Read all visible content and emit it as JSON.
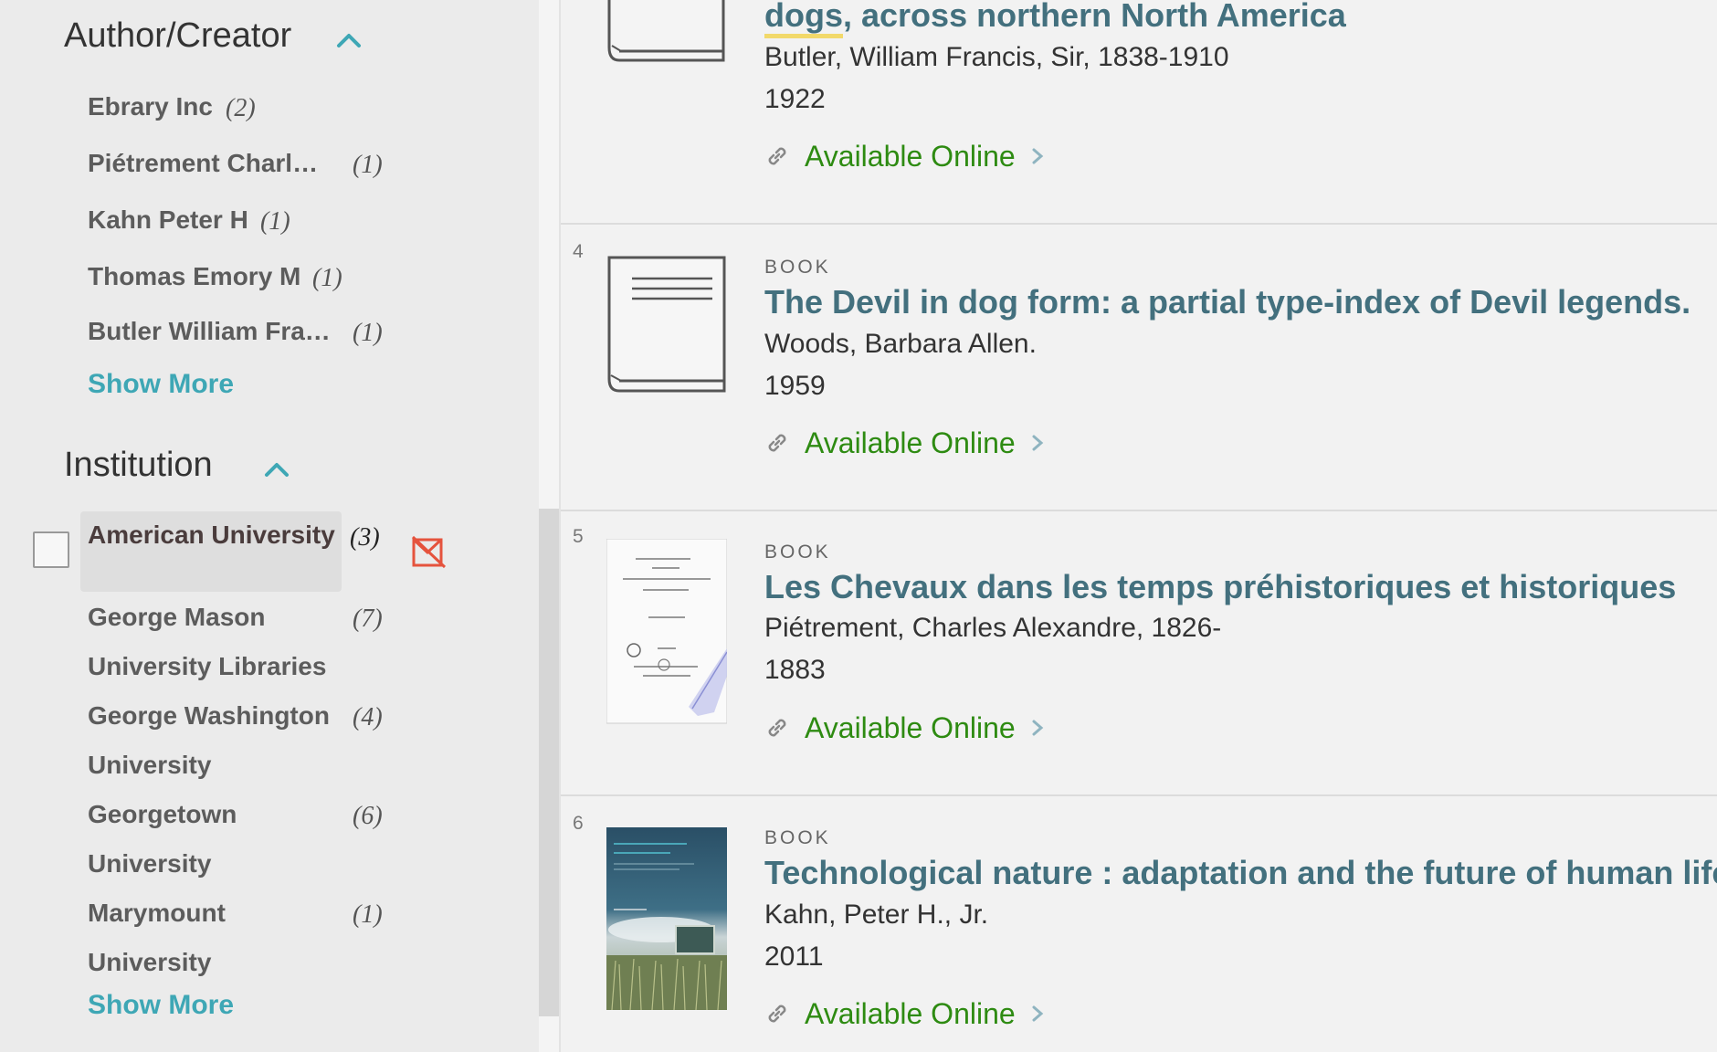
{
  "sidebar": {
    "author_section": {
      "title": "Author/Creator",
      "items": [
        {
          "label": "Ebrary Inc",
          "count": "(2)"
        },
        {
          "label": "Piétrement Charl…",
          "count": "(1)"
        },
        {
          "label": "Kahn Peter H",
          "count": "(1)"
        },
        {
          "label": "Thomas Emory M",
          "count": "(1)"
        },
        {
          "label": "Butler William Fra…",
          "count": "(1)"
        }
      ],
      "show_more": "Show More"
    },
    "institution_section": {
      "title": "Institution",
      "selected": {
        "label": "American University",
        "count": "(3)"
      },
      "items": [
        {
          "line1": "George Mason",
          "line2": "University Libraries",
          "count": "(7)"
        },
        {
          "line1": "George Washington",
          "line2": "University",
          "count": "(4)"
        },
        {
          "line1": "Georgetown",
          "line2": "University",
          "count": "(6)"
        },
        {
          "line1": "Marymount",
          "line2": "University",
          "count": "(1)"
        }
      ],
      "show_more": "Show More"
    }
  },
  "results": [
    {
      "title_part1": "dogs",
      "title_part2": ", across northern North America",
      "author": "Butler, William Francis, Sir, 1838-1910",
      "year": "1922",
      "availability": "Available Online"
    },
    {
      "number": "4",
      "type": "BOOK",
      "title": "The Devil in dog form: a partial type-index of Devil legends.",
      "author": "Woods, Barbara Allen.",
      "year": "1959",
      "availability": "Available Online"
    },
    {
      "number": "5",
      "type": "BOOK",
      "title": "Les Chevaux dans les temps préhistoriques et historiques",
      "author": "Piétrement, Charles Alexandre, 1826-",
      "year": "1883",
      "availability": "Available Online"
    },
    {
      "number": "6",
      "type": "BOOK",
      "title": "Technological nature : adaptation and the future of human life",
      "author": "Kahn, Peter H., Jr.",
      "year": "2011",
      "availability": "Available Online"
    }
  ],
  "colors": {
    "link_teal": "#43707e",
    "available_green": "#2e8b12",
    "show_more_teal": "#3ea7b5",
    "exclude_red": "#e5533d"
  }
}
